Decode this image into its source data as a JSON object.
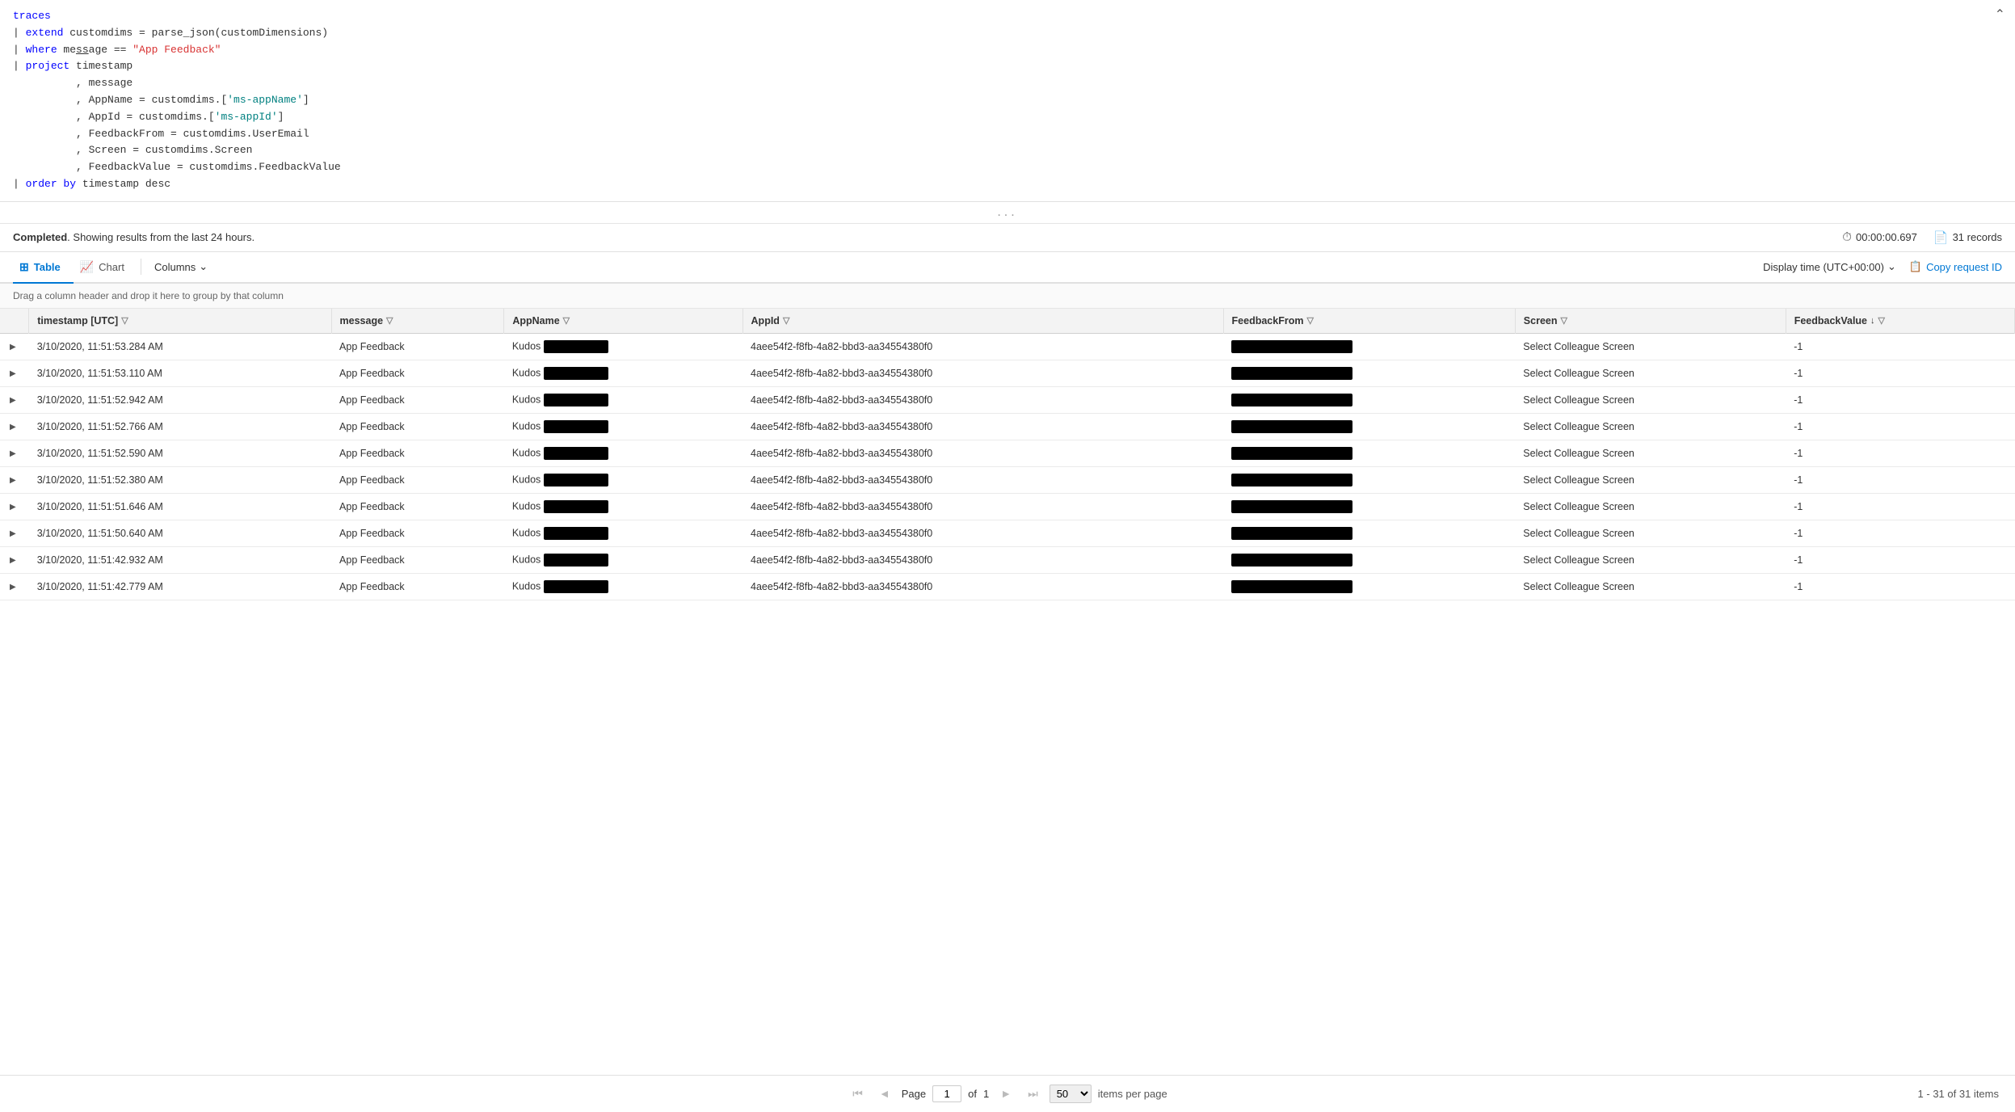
{
  "editor": {
    "lines": [
      {
        "id": 1,
        "content": "traces",
        "type": "plain"
      },
      {
        "id": 2,
        "content": "| extend customdims = parse_json(customDimensions)",
        "type": "mixed"
      },
      {
        "id": 3,
        "content": "| where message == \"App Feedback\"",
        "type": "mixed"
      },
      {
        "id": 4,
        "content": "| project timestamp",
        "type": "mixed"
      },
      {
        "id": 5,
        "content": "          , message",
        "type": "plain"
      },
      {
        "id": 6,
        "content": "          , AppName = customdims.['ms-appName']",
        "type": "mixed"
      },
      {
        "id": 7,
        "content": "          , AppId = customdims.['ms-appId']",
        "type": "mixed"
      },
      {
        "id": 8,
        "content": "          , FeedbackFrom = customdims.UserEmail",
        "type": "plain"
      },
      {
        "id": 9,
        "content": "          , Screen = customdims.Screen",
        "type": "plain"
      },
      {
        "id": 10,
        "content": "          , FeedbackValue = customdims.FeedbackValue",
        "type": "plain"
      },
      {
        "id": 11,
        "content": "| order by timestamp desc",
        "type": "mixed"
      }
    ]
  },
  "status": {
    "message": "Completed",
    "detail": ". Showing results from the last 24 hours.",
    "timer_label": "00:00:00.697",
    "records_label": "31 records"
  },
  "tabs": {
    "table_label": "Table",
    "chart_label": "Chart",
    "columns_label": "Columns",
    "display_time_label": "Display time (UTC+00:00)",
    "copy_request_label": "Copy request ID"
  },
  "drag_hint": "Drag a column header and drop it here to group by that column",
  "columns": [
    {
      "id": "expand",
      "label": "",
      "filter": false,
      "sort": false
    },
    {
      "id": "timestamp",
      "label": "timestamp [UTC]",
      "filter": true,
      "sort": false
    },
    {
      "id": "message",
      "label": "message",
      "filter": true,
      "sort": false
    },
    {
      "id": "appname",
      "label": "AppName",
      "filter": true,
      "sort": false
    },
    {
      "id": "appid",
      "label": "AppId",
      "filter": true,
      "sort": false
    },
    {
      "id": "feedbackfrom",
      "label": "FeedbackFrom",
      "filter": true,
      "sort": false
    },
    {
      "id": "screen",
      "label": "Screen",
      "filter": true,
      "sort": false
    },
    {
      "id": "feedbackvalue",
      "label": "FeedbackValue",
      "filter": true,
      "sort": true
    }
  ],
  "rows": [
    {
      "timestamp": "3/10/2020, 11:51:53.284 AM",
      "message": "App Feedback",
      "appname": "Kudos",
      "appid": "4aee54f2-f8fb-4a82-bbd3-aa34554380f0",
      "feedbackfrom": true,
      "screen": "Select Colleague Screen",
      "feedbackvalue": "-1"
    },
    {
      "timestamp": "3/10/2020, 11:51:53.110 AM",
      "message": "App Feedback",
      "appname": "Kudos",
      "appid": "4aee54f2-f8fb-4a82-bbd3-aa34554380f0",
      "feedbackfrom": true,
      "screen": "Select Colleague Screen",
      "feedbackvalue": "-1"
    },
    {
      "timestamp": "3/10/2020, 11:51:52.942 AM",
      "message": "App Feedback",
      "appname": "Kudos",
      "appid": "4aee54f2-f8fb-4a82-bbd3-aa34554380f0",
      "feedbackfrom": true,
      "screen": "Select Colleague Screen",
      "feedbackvalue": "-1"
    },
    {
      "timestamp": "3/10/2020, 11:51:52.766 AM",
      "message": "App Feedback",
      "appname": "Kudos",
      "appid": "4aee54f2-f8fb-4a82-bbd3-aa34554380f0",
      "feedbackfrom": true,
      "screen": "Select Colleague Screen",
      "feedbackvalue": "-1"
    },
    {
      "timestamp": "3/10/2020, 11:51:52.590 AM",
      "message": "App Feedback",
      "appname": "Kudos",
      "appid": "4aee54f2-f8fb-4a82-bbd3-aa34554380f0",
      "feedbackfrom": true,
      "screen": "Select Colleague Screen",
      "feedbackvalue": "-1"
    },
    {
      "timestamp": "3/10/2020, 11:51:52.380 AM",
      "message": "App Feedback",
      "appname": "Kudos",
      "appid": "4aee54f2-f8fb-4a82-bbd3-aa34554380f0",
      "feedbackfrom": true,
      "screen": "Select Colleague Screen",
      "feedbackvalue": "-1"
    },
    {
      "timestamp": "3/10/2020, 11:51:51.646 AM",
      "message": "App Feedback",
      "appname": "Kudos",
      "appid": "4aee54f2-f8fb-4a82-bbd3-aa34554380f0",
      "feedbackfrom": true,
      "screen": "Select Colleague Screen",
      "feedbackvalue": "-1"
    },
    {
      "timestamp": "3/10/2020, 11:51:50.640 AM",
      "message": "App Feedback",
      "appname": "Kudos",
      "appid": "4aee54f2-f8fb-4a82-bbd3-aa34554380f0",
      "feedbackfrom": true,
      "screen": "Select Colleague Screen",
      "feedbackvalue": "-1"
    },
    {
      "timestamp": "3/10/2020, 11:51:42.932 AM",
      "message": "App Feedback",
      "appname": "Kudos",
      "appid": "4aee54f2-f8fb-4a82-bbd3-aa34554380f0",
      "feedbackfrom": true,
      "screen": "Select Colleague Screen",
      "feedbackvalue": "-1"
    },
    {
      "timestamp": "3/10/2020, 11:51:42.779 AM",
      "message": "App Feedback",
      "appname": "Kudos",
      "appid": "4aee54f2-f8fb-4a82-bbd3-aa34554380f0",
      "feedbackfrom": true,
      "screen": "Select Colleague Screen",
      "feedbackvalue": "-1"
    }
  ],
  "pagination": {
    "page_label": "Page",
    "current_page": "1",
    "of_label": "of",
    "total_pages": "1",
    "per_page": "50",
    "items_per_page_label": "items per page",
    "range_label": "1 - 31 of 31 items"
  }
}
